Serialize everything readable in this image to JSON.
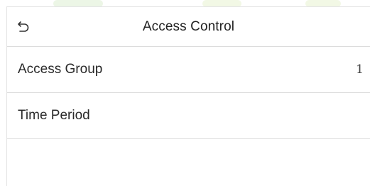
{
  "header": {
    "back_icon": "back-arrow-icon",
    "title": "Access Control"
  },
  "menu": {
    "items": [
      {
        "label": "Access Group",
        "value": "1"
      },
      {
        "label": "Time Period",
        "value": ""
      }
    ]
  }
}
